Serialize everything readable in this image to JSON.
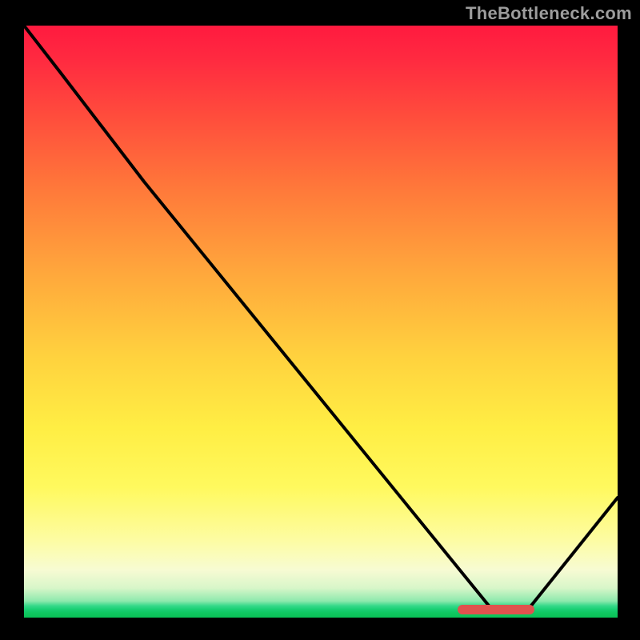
{
  "watermark": "TheBottleneck.com",
  "chart_data": {
    "type": "line",
    "title": "",
    "xlabel": "",
    "ylabel": "",
    "xlim": [
      0,
      100
    ],
    "ylim": [
      0,
      100
    ],
    "grid": false,
    "legend": false,
    "background_gradient": {
      "stops": [
        {
          "pos": 0,
          "color": "#ff1a3f"
        },
        {
          "pos": 28,
          "color": "#ff7a3a"
        },
        {
          "pos": 56,
          "color": "#ffd23e"
        },
        {
          "pos": 78,
          "color": "#fff95e"
        },
        {
          "pos": 92,
          "color": "#f7fbd3"
        },
        {
          "pos": 98,
          "color": "#19cf74"
        },
        {
          "pos": 100,
          "color": "#0ac257"
        }
      ]
    },
    "series": [
      {
        "name": "bottleneck-curve",
        "color": "#000000",
        "x": [
          0,
          6,
          20,
          79,
          85,
          100
        ],
        "y": [
          100,
          92,
          74,
          1,
          1,
          20
        ]
      },
      {
        "name": "optimal-segment",
        "color": "#e0524e",
        "x": [
          74,
          85
        ],
        "y": [
          1.2,
          1.2
        ]
      }
    ],
    "annotations": []
  }
}
